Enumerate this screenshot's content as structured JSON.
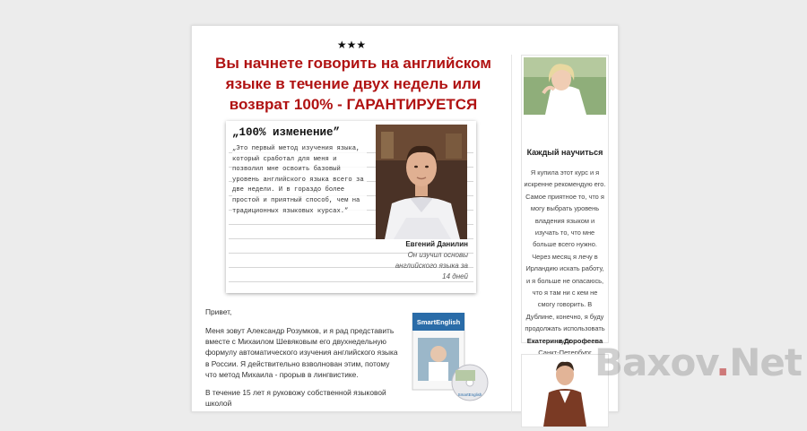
{
  "stars": "★★★",
  "headline": "Вы начнете говорить на английском языке в течение двух недель или возврат 100% - ГАРАНТИРУЕТСЯ",
  "testimonial": {
    "title": "„100% изменение”",
    "quote": "„Это первый метод изучения языка, который сработал для меня и позволил мне освоить базовый уровень английского языка всего за две недели. И в гораздо более простой и приятный способ, чем на традиционных языковых курсах.”",
    "name": "Евгений Данилин",
    "description": "Он изучил основы английского языка за 14 дней"
  },
  "body": {
    "greeting": "Привет,",
    "paragraph1": "Меня зовут Александр Розумков, и я рад представить вместе с Михаилом Шевяковым его двухнедельную формулу автоматического изучения английского языка в России. Я действительно взволнован этим, потому что метод Михаила - прорыв в лингвистике.",
    "paragraph2": "В течение 15 лет я руковожу собственной языковой школой"
  },
  "product": {
    "brand": "SmartEnglish",
    "disc_label": "SmartEnglish"
  },
  "sidebar": {
    "title": "Каждый научиться",
    "text": "Я купила этот курс и я искренне рекомендую его. Самое приятное то, что я могу выбрать уровень владения языком и изучать то, что мне больше всего нужно. Через месяц я лечу в Ирландию искать работу, и я больше не опасаюсь, что я там ни с кем не смогу говорить. В Дублине, конечно, я буду продолжать использовать курс",
    "name": "Екатерина Дорофеева",
    "city": "Санкт-Петербург"
  },
  "watermark": {
    "part1": "Baxov",
    "dot": ".",
    "part2": "Net"
  },
  "colors": {
    "headline": "#b01212",
    "background": "#ececec"
  }
}
